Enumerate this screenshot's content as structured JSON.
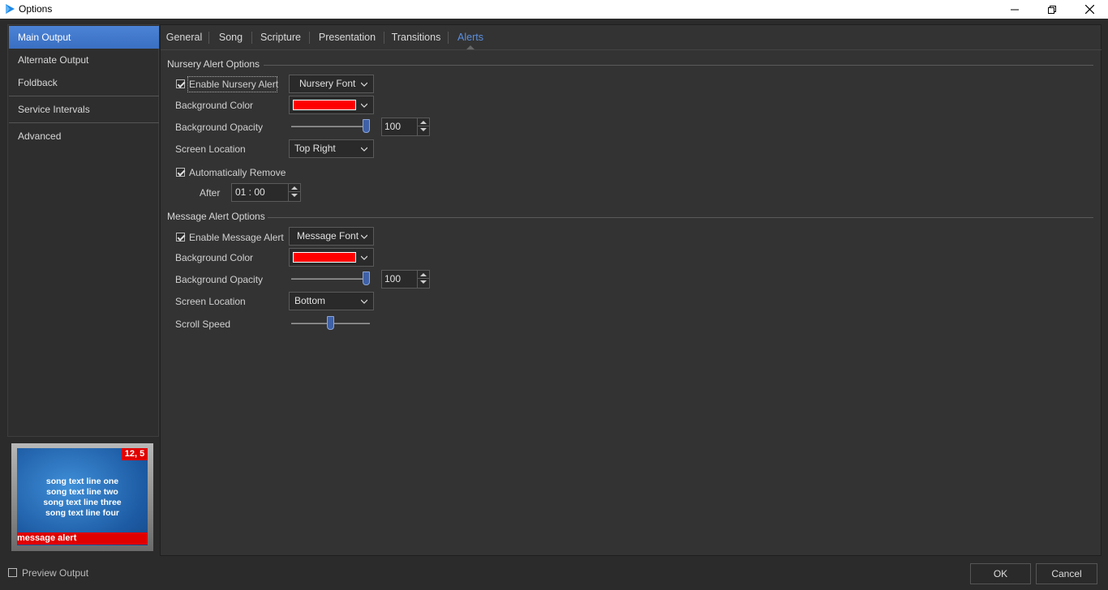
{
  "window": {
    "title": "Options",
    "minimize_icon": "minimize-icon",
    "restore_icon": "restore-icon",
    "close_icon": "close-icon"
  },
  "sidebar": {
    "items": [
      {
        "label": "Main Output",
        "active": true
      },
      {
        "label": "Alternate Output",
        "active": false
      },
      {
        "label": "Foldback",
        "active": false
      },
      {
        "label": "Service Intervals",
        "active": false
      },
      {
        "label": "Advanced",
        "active": false
      }
    ]
  },
  "preview": {
    "badge": "12, 5",
    "lines": [
      "song text line one",
      "song text line two",
      "song text line three",
      "song text line four"
    ],
    "alert": "message alert"
  },
  "tabs": [
    {
      "label": "General",
      "active": false
    },
    {
      "label": "Song",
      "active": false
    },
    {
      "label": "Scripture",
      "active": false
    },
    {
      "label": "Presentation",
      "active": false
    },
    {
      "label": "Transitions",
      "active": false
    },
    {
      "label": "Alerts",
      "active": true
    }
  ],
  "nursery": {
    "title": "Nursery Alert Options",
    "enable_label": "Enable Nursery Alert",
    "enable_checked": true,
    "font_button": "Nursery Font",
    "bg_color_label": "Background Color",
    "bg_color": "#ff0000",
    "opacity_label": "Background Opacity",
    "opacity_value": "100",
    "opacity_fraction": 1.0,
    "location_label": "Screen Location",
    "location_value": "Top Right",
    "auto_remove_label": "Automatically Remove",
    "auto_remove_checked": true,
    "after_label": "After",
    "after_value": "01 : 00"
  },
  "message": {
    "title": "Message Alert Options",
    "enable_label": "Enable Message Alert",
    "enable_checked": true,
    "font_button": "Message Font",
    "bg_color_label": "Background Color",
    "bg_color": "#ff0000",
    "opacity_label": "Background Opacity",
    "opacity_value": "100",
    "opacity_fraction": 1.0,
    "location_label": "Screen Location",
    "location_value": "Bottom",
    "scroll_label": "Scroll Speed",
    "scroll_fraction": 0.5
  },
  "footer": {
    "preview_label": "Preview Output",
    "preview_checked": false,
    "ok_label": "OK",
    "cancel_label": "Cancel"
  },
  "colors": {
    "accent": "#4c83d6",
    "active_tab": "#5b8fe0",
    "alert_red": "#e00000"
  }
}
